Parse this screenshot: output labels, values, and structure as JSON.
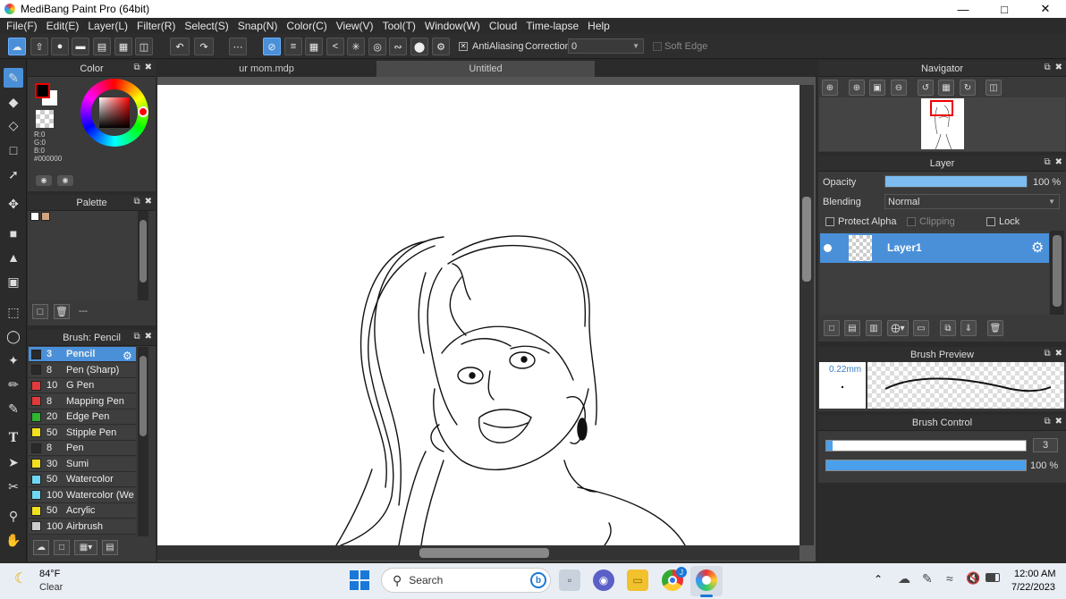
{
  "window": {
    "title": "MediBang Paint Pro (64bit)",
    "minimize": "—",
    "maximize": "□",
    "close": "✕"
  },
  "menu": [
    "File(F)",
    "Edit(E)",
    "Layer(L)",
    "Filter(R)",
    "Select(S)",
    "Snap(N)",
    "Color(C)",
    "View(V)",
    "Tool(T)",
    "Window(W)",
    "Cloud",
    "Time-lapse",
    "Help"
  ],
  "toolbar": {
    "antialiasing_label": "AntiAliasing",
    "antialiasing_checked": "✕",
    "correction_label": "Correction",
    "correction_value": "0",
    "soft_edge_label": "Soft Edge"
  },
  "color_panel": {
    "title": "Color",
    "r": "R:0",
    "g": "G:0",
    "b": "B:0",
    "hex": "#000000",
    "foreground": "#000000",
    "background": "#ffffff"
  },
  "palette_panel": {
    "title": "Palette",
    "dash": "---",
    "swatches": [
      "#ffffff",
      "#d2a27e"
    ]
  },
  "brush_panel": {
    "title": "Brush: Pencil",
    "items": [
      {
        "size": "3",
        "name": "Pencil",
        "color": "#2a2a2a"
      },
      {
        "size": "8",
        "name": "Pen (Sharp)",
        "color": "#2a2a2a"
      },
      {
        "size": "10",
        "name": "G Pen",
        "color": "#e23a3a"
      },
      {
        "size": "8",
        "name": "Mapping Pen",
        "color": "#e23a3a"
      },
      {
        "size": "20",
        "name": "Edge Pen",
        "color": "#2fb52f"
      },
      {
        "size": "50",
        "name": "Stipple Pen",
        "color": "#f0e020"
      },
      {
        "size": "8",
        "name": "Pen",
        "color": "#2a2a2a"
      },
      {
        "size": "30",
        "name": "Sumi",
        "color": "#f0e020"
      },
      {
        "size": "50",
        "name": "Watercolor",
        "color": "#6fd6f2"
      },
      {
        "size": "100",
        "name": "Watercolor (We",
        "color": "#6fd6f2"
      },
      {
        "size": "50",
        "name": "Acrylic",
        "color": "#f0e020"
      },
      {
        "size": "100",
        "name": "Airbrush",
        "color": "#cccccc"
      }
    ]
  },
  "tabs": [
    {
      "label": "ur mom.mdp"
    },
    {
      "label": "Untitled"
    }
  ],
  "navigator": {
    "title": "Navigator"
  },
  "layer_panel": {
    "title": "Layer",
    "opacity_label": "Opacity",
    "opacity_value": "100 %",
    "opacity_fraction": 1.0,
    "blending_label": "Blending",
    "blending_value": "Normal",
    "protect_alpha": "Protect Alpha",
    "clipping": "Clipping",
    "lock": "Lock",
    "layers": [
      {
        "name": "Layer1"
      }
    ]
  },
  "brush_preview": {
    "title": "Brush Preview",
    "size": "0.22mm"
  },
  "brush_control": {
    "title": "Brush Control",
    "size_value": "3",
    "opacity_value": "100 %",
    "size_fraction": 0.03,
    "opacity_fraction": 1.0
  },
  "taskbar": {
    "weather_temp": "84°F",
    "weather_desc": "Clear",
    "search_placeholder": "Search",
    "time": "12:00 AM",
    "date": "7/22/2023",
    "chrome_badge": "J"
  }
}
